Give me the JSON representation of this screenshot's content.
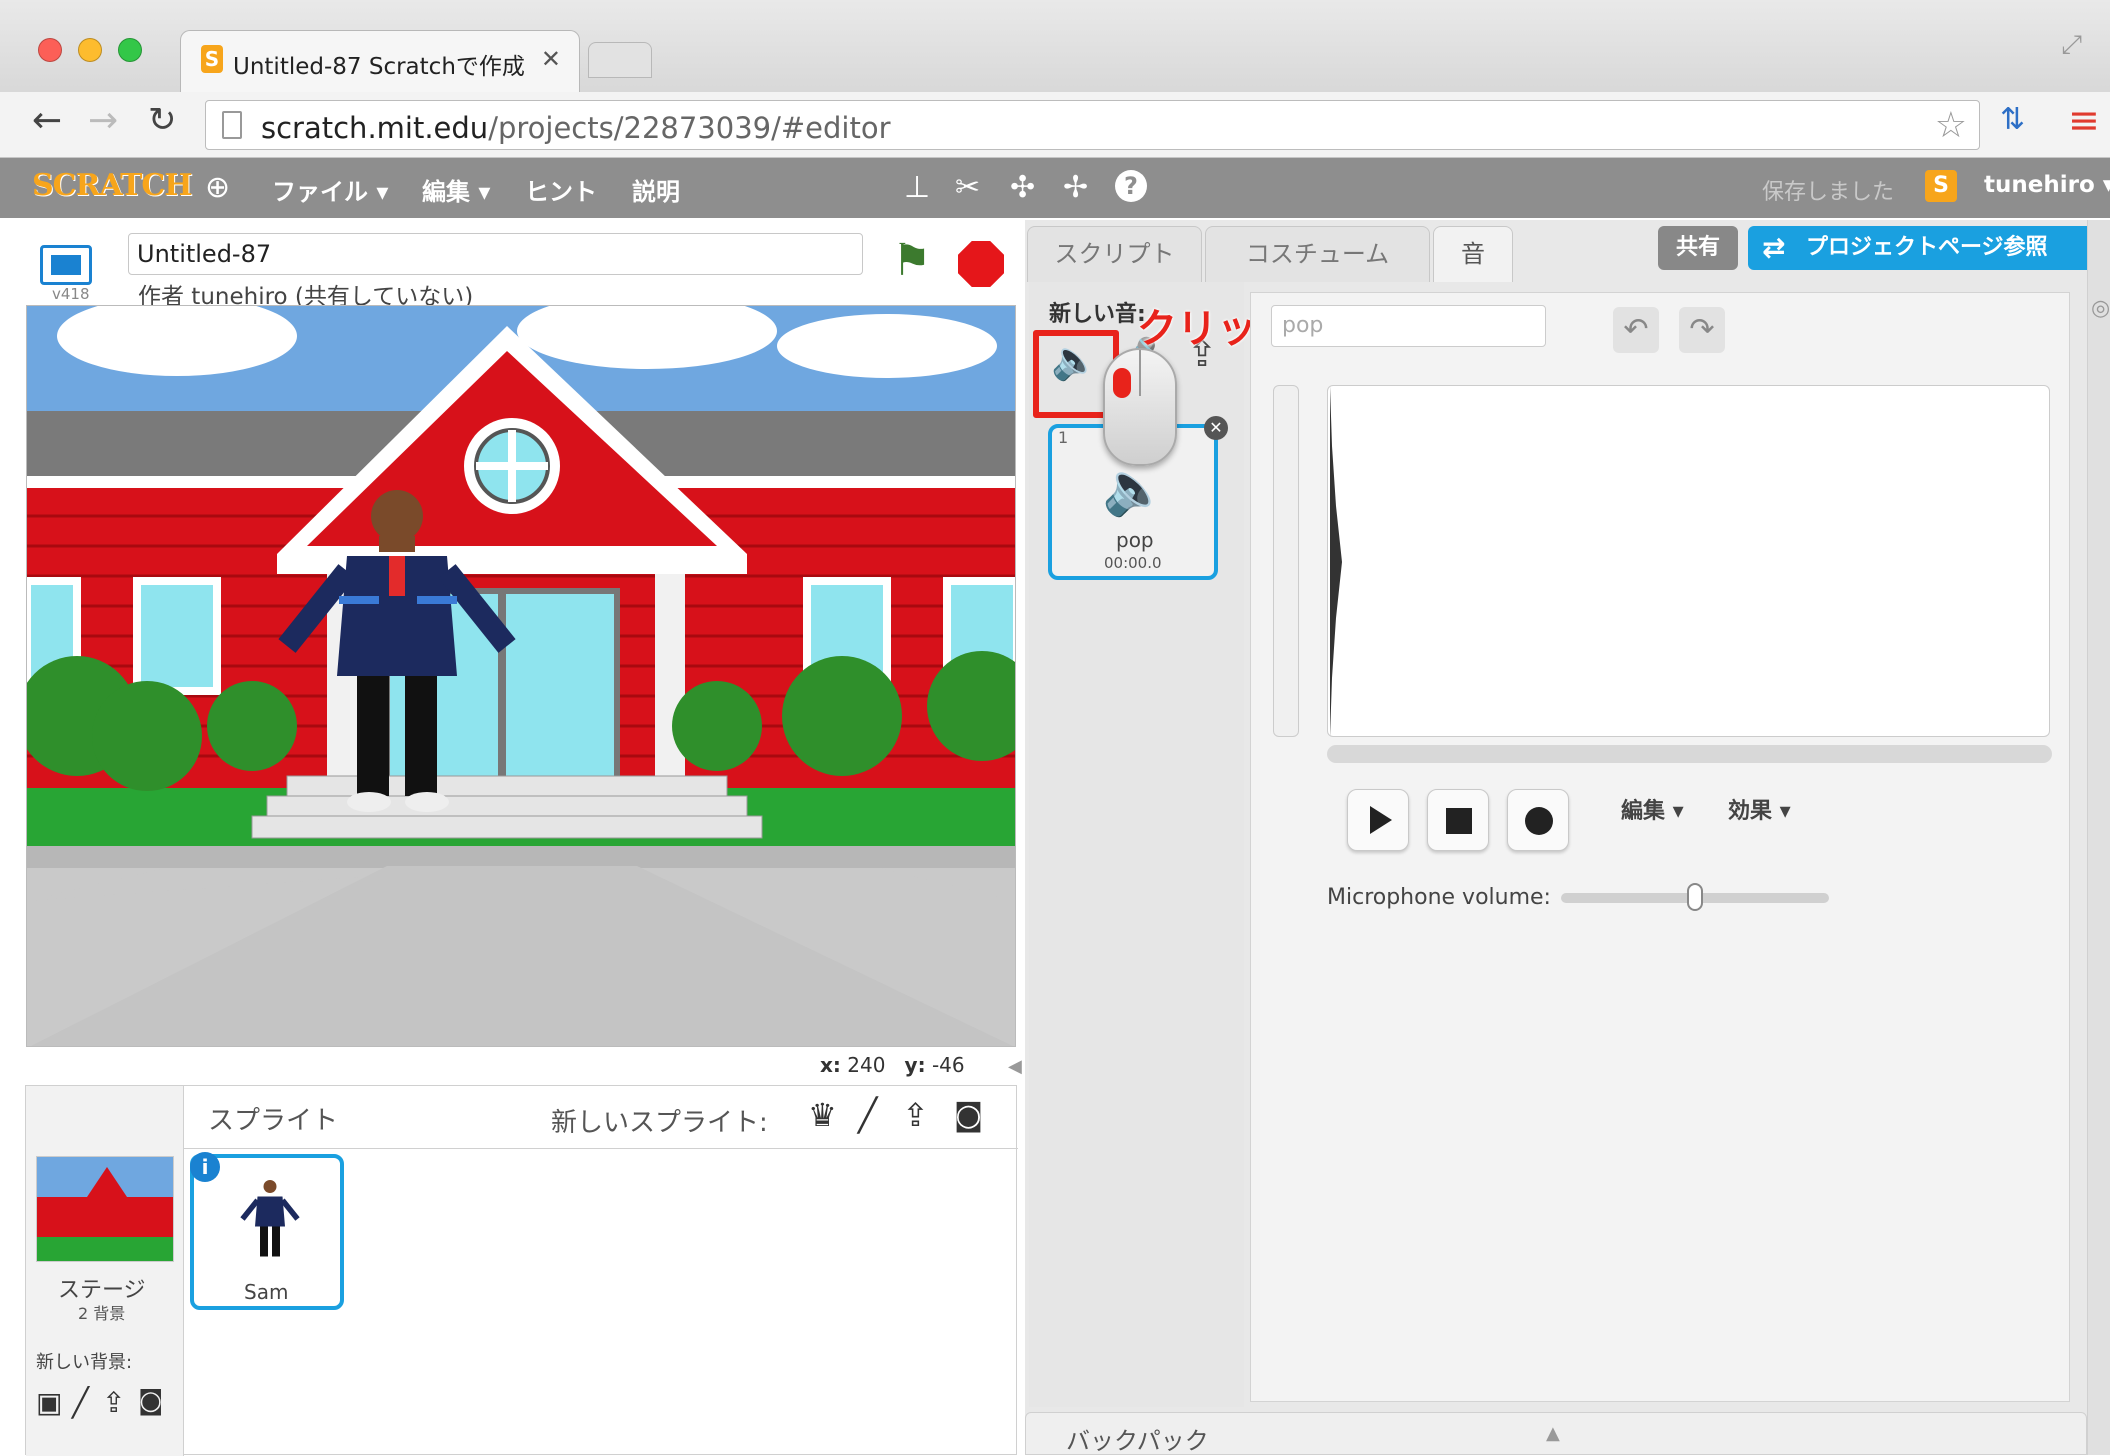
{
  "browser": {
    "tab_title": "Untitled-87 Scratchで作成",
    "url_host": "scratch.mit.edu",
    "url_path": "/projects/22873039/#editor"
  },
  "menubar": {
    "logo": "SCRATCH",
    "file": "ファイル ▾",
    "edit": "編集 ▾",
    "tips": "ヒント",
    "about": "説明",
    "saved": "保存しました",
    "username": "tunehiro ▾"
  },
  "stage": {
    "version": "v418",
    "project_title": "Untitled-87",
    "author_line": "作者 tunehiro (共有していない)",
    "x_label": "x:",
    "x_value": "240",
    "y_label": "y:",
    "y_value": "-46"
  },
  "sprites": {
    "header": "スプライト",
    "new_sprite": "新しいスプライト:",
    "stage_label": "ステージ",
    "stage_backdrops": "2 背景",
    "new_backdrop": "新しい背景:",
    "sprite_name": "Sam"
  },
  "editor": {
    "tabs": [
      "スクリプト",
      "コスチューム",
      "音"
    ],
    "share_button": "共有",
    "project_page_button": "プロジェクトページ参照",
    "new_sound": "新しい音:",
    "annotation": "クリック",
    "sound_name_field": "pop",
    "sound_item_name": "pop",
    "sound_item_duration": "00:00.0",
    "sound_item_index": "1",
    "edit_menu": "編集 ▾",
    "effects_menu": "効果 ▾",
    "mic_volume_label": "Microphone volume:",
    "mic_volume": 0.5,
    "backpack": "バックパック"
  },
  "colors": {
    "accent_blue": "#1aa0e0",
    "menubar_gray": "#8e8e8e",
    "annotation_red": "#e8231b"
  }
}
